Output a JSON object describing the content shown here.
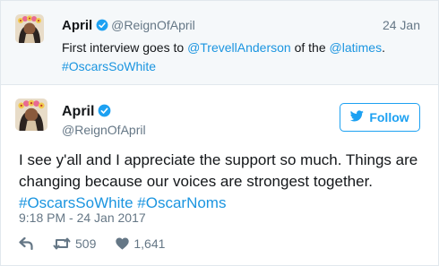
{
  "parent_tweet": {
    "name": "April",
    "handle": "@ReignOfApril",
    "date": "24 Jan",
    "text_part1": "First interview goes to ",
    "mention1": "@TrevellAnderson",
    "text_part2": " of the ",
    "mention2": "@latimes",
    "text_part3": ".",
    "hashtag": "#OscarsSoWhite"
  },
  "main_tweet": {
    "name": "April",
    "handle": "@ReignOfApril",
    "follow_label": "Follow",
    "text": "I see y'all and I appreciate the support so much. Things are changing because our voices are strongest together.",
    "hashtag1": "#OscarsSoWhite",
    "hashtag2": "#OscarNoms",
    "timestamp": "9:18 PM - 24 Jan 2017",
    "retweet_count": "509",
    "like_count": "1,641"
  },
  "icons": {
    "verified": "verified-badge-icon",
    "follow": "twitter-bird-icon",
    "reply": "reply-icon",
    "retweet": "retweet-icon",
    "like": "heart-icon"
  },
  "colors": {
    "link": "#1b95e0",
    "accent": "#1da1f2",
    "muted": "#657786",
    "text": "#14171a",
    "parent_bg": "#f5f8fa",
    "border": "#e1e8ed"
  }
}
